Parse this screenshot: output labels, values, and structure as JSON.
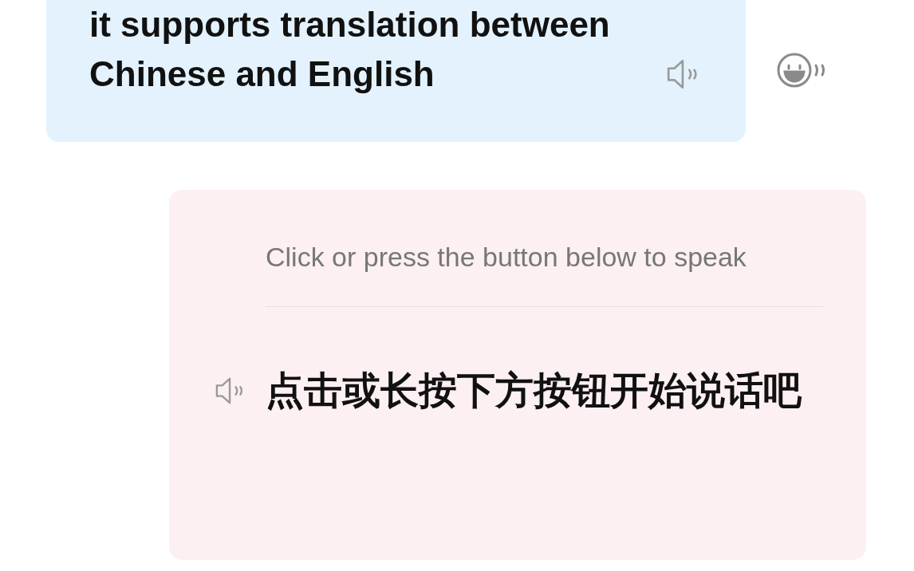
{
  "messages": [
    {
      "kind": "translation",
      "text": "it supports translation between Chinese and English"
    },
    {
      "kind": "prompt",
      "source": "Click or press the button below to speak",
      "translation": "点击或长按下方按钮开始说话吧"
    }
  ]
}
